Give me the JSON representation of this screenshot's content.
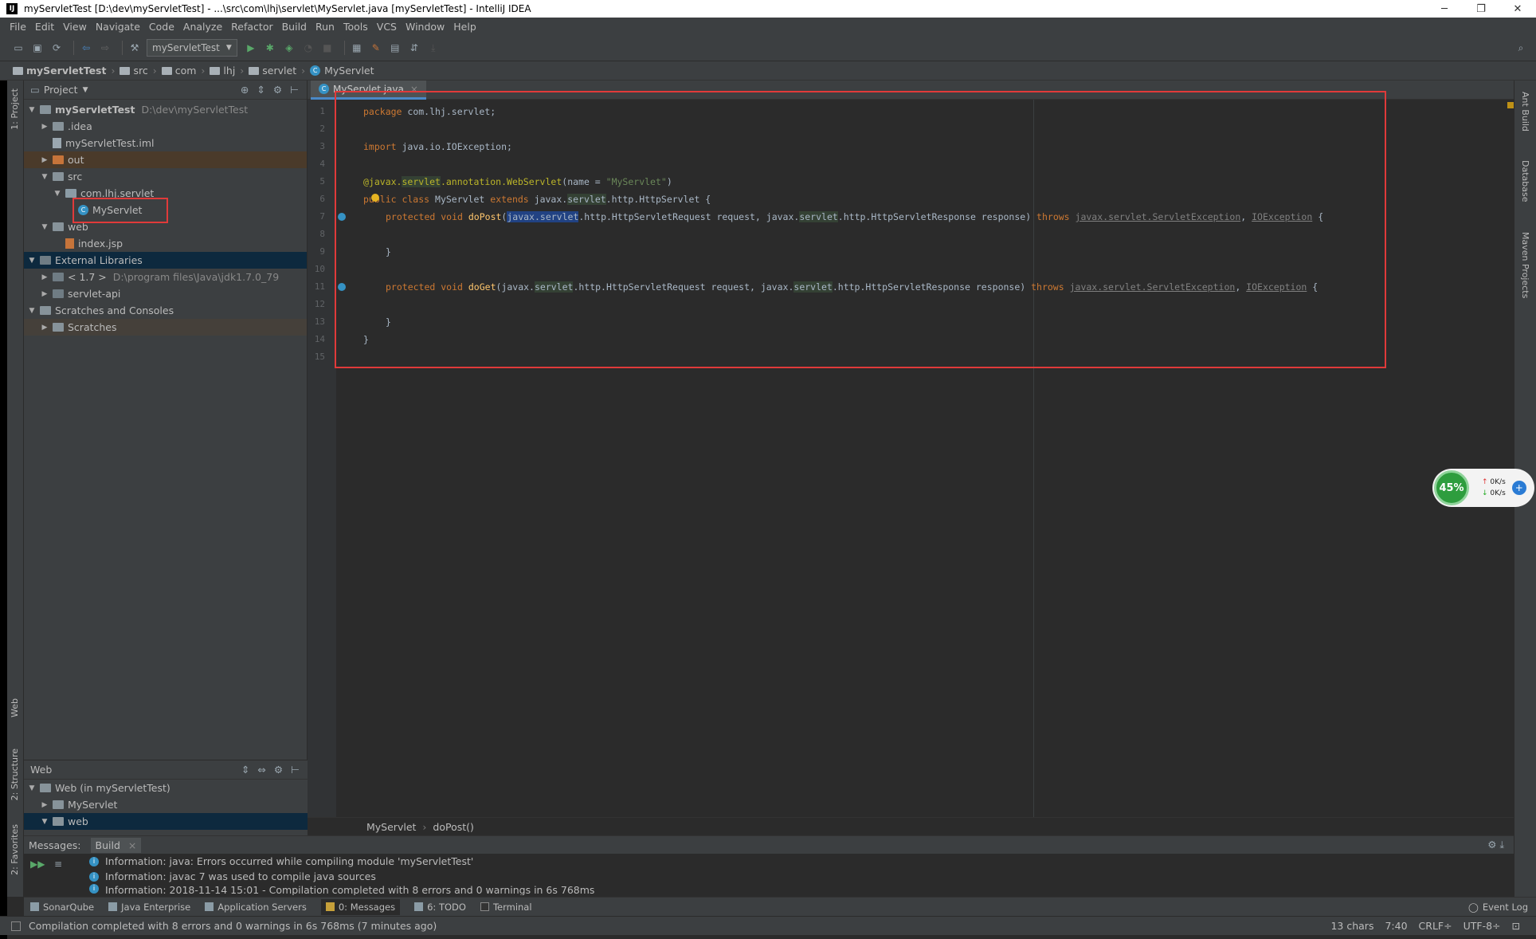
{
  "window": {
    "title": "myServletTest [D:\\dev\\myServletTest] - ...\\src\\com\\lhj\\servlet\\MyServlet.java [myServletTest] - IntelliJ IDEA",
    "logo": "IJ",
    "minimize": "─",
    "maximize": "❐",
    "close": "✕"
  },
  "menu": [
    "File",
    "Edit",
    "View",
    "Navigate",
    "Code",
    "Analyze",
    "Refactor",
    "Build",
    "Run",
    "Tools",
    "VCS",
    "Window",
    "Help"
  ],
  "toolbar": {
    "run_config": "myServletTest"
  },
  "breadcrumbs": [
    "myServletTest",
    "src",
    "com",
    "lhj",
    "servlet",
    "MyServlet"
  ],
  "project_panel": {
    "title": "Project",
    "tree": [
      {
        "label": "myServletTest",
        "extra": "D:\\dev\\myServletTest",
        "level": 0,
        "expanded": true,
        "icon": "module-folder-icon"
      },
      {
        "label": ".idea",
        "level": 1,
        "expanded": false,
        "icon": "folder-icon"
      },
      {
        "label": "myServletTest.iml",
        "level": 1,
        "icon": "iml-file-icon"
      },
      {
        "label": "out",
        "level": 1,
        "expanded": false,
        "icon": "output-folder-icon"
      },
      {
        "label": "src",
        "level": 1,
        "expanded": true,
        "icon": "source-folder-icon"
      },
      {
        "label": "com.lhj.servlet",
        "level": 2,
        "expanded": true,
        "icon": "package-icon"
      },
      {
        "label": "MyServlet",
        "level": 3,
        "icon": "class-icon"
      },
      {
        "label": "web",
        "level": 1,
        "expanded": true,
        "icon": "web-folder-icon"
      },
      {
        "label": "index.jsp",
        "level": 2,
        "icon": "jsp-file-icon"
      },
      {
        "label": "External Libraries",
        "level": 0,
        "expanded": true,
        "icon": "library-icon"
      },
      {
        "label": "< 1.7 >",
        "extra": "D:\\program files\\Java\\jdk1.7.0_79",
        "level": 1,
        "expanded": false,
        "icon": "jdk-icon"
      },
      {
        "label": "servlet-api",
        "level": 1,
        "expanded": false,
        "icon": "library-icon"
      },
      {
        "label": "Scratches and Consoles",
        "level": 0,
        "expanded": true,
        "icon": "scratches-icon"
      },
      {
        "label": "Scratches",
        "level": 1,
        "expanded": false,
        "icon": "folder-icon"
      }
    ]
  },
  "web_panel": {
    "title": "Web",
    "tree": [
      {
        "label": "Web (in myServletTest)",
        "level": 0,
        "expanded": true
      },
      {
        "label": "MyServlet",
        "level": 1,
        "expanded": false
      },
      {
        "label": "web",
        "level": 1,
        "expanded": true
      }
    ]
  },
  "editor": {
    "tab": "MyServlet.java",
    "line_numbers": [
      "1",
      "2",
      "3",
      "4",
      "5",
      "6",
      "7",
      "8",
      "9",
      "10",
      "11",
      "12",
      "13",
      "14",
      "15"
    ],
    "breadcrumb": [
      "MyServlet",
      "doPost()"
    ]
  },
  "left_tool_tabs": [
    "1: Project",
    "Web",
    "2: Structure",
    "2: Favorites"
  ],
  "right_tool_tabs": [
    "Ant Build",
    "Database",
    "Maven Projects"
  ],
  "messages": {
    "label": "Messages:",
    "tab": "Build",
    "lines": [
      "Information: java: Errors occurred while compiling module 'myServletTest'",
      "Information: javac 7 was used to compile java sources",
      "Information: 2018-11-14 15:01 - Compilation completed with 8 errors and 0 warnings in 6s 768ms"
    ]
  },
  "bottom_tabs": [
    "SonarQube",
    "Java Enterprise",
    "Application Servers",
    "0: Messages",
    "6: TODO",
    "Terminal"
  ],
  "event_log": "Event Log",
  "status": {
    "message": "Compilation completed with 8 errors and 0 warnings in 6s 768ms (7 minutes ago)",
    "chars": "13 chars",
    "position": "7:40",
    "line_sep": "CRLF÷",
    "encoding": "UTF-8÷"
  },
  "net_widget": {
    "percent": "45%",
    "up": "0K/s",
    "down": "0K/s"
  },
  "colors": {
    "keyword": "#cc7832",
    "string": "#6a8759",
    "annotation": "#bbb529",
    "function": "#ffc66d",
    "highlight_box": "#e03a3a"
  }
}
